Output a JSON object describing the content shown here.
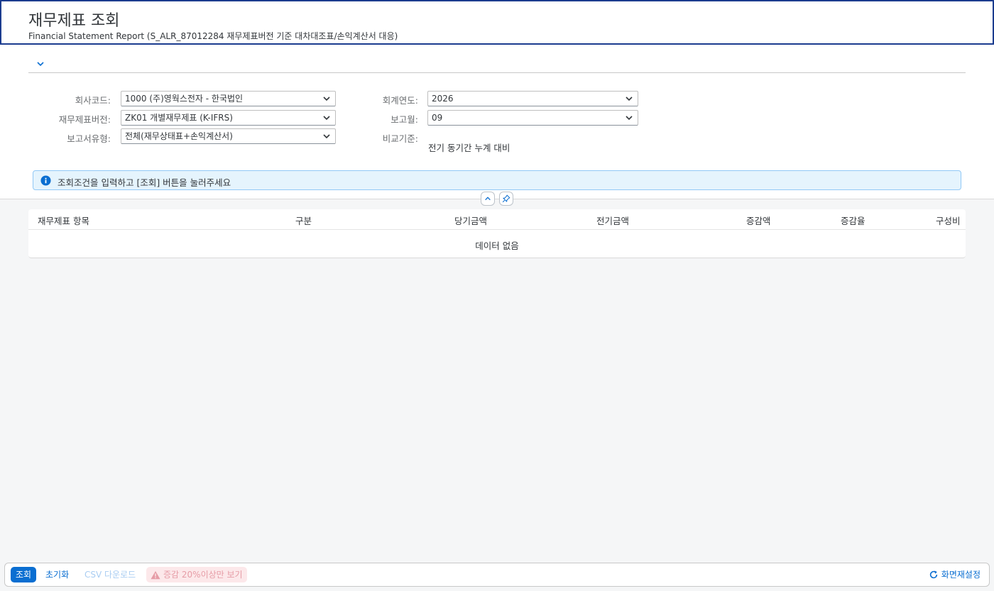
{
  "header": {
    "title": "재무제표 조회",
    "subtitle": "Financial Statement Report (S_ALR_87012284 재무제표버전 기준 대차대조표/손익계산서 대응)"
  },
  "filters": {
    "company_code": {
      "label": "회사코드:",
      "value": "1000 (주)영웍스전자 - 한국법인"
    },
    "fs_version": {
      "label": "재무제표버전:",
      "value": "ZK01 개별재무제표 (K-IFRS)"
    },
    "report_type": {
      "label": "보고서유형:",
      "value": "전체(재무상태표+손익계산서)"
    },
    "fiscal_year": {
      "label": "회계연도:",
      "value": "2026"
    },
    "period": {
      "label": "보고월:",
      "value": "09"
    },
    "comparison": {
      "label": "비교기준:",
      "value": "전기 동기간 누계 대비"
    }
  },
  "info_message": "조회조건을 입력하고 [조회] 버튼을 눌러주세요",
  "table": {
    "columns": [
      "재무제표 항목",
      "구분",
      "당기금액",
      "전기금액",
      "증감액",
      "증감율",
      "구성비"
    ],
    "empty_text": "데이터 없음"
  },
  "footer": {
    "search_label": "조회",
    "reset_label": "초기화",
    "csv_label": "CSV 다운로드",
    "filter_label": "증감 20%이상만 보기",
    "screen_reset_label": "화면재설정"
  },
  "colors": {
    "primary": "#0a6ed1",
    "header_border": "#1b3c8f",
    "info_bg": "#e5f4fd",
    "warn_bg": "#fce8ea"
  },
  "icons": {
    "expand": "chevron-down-icon",
    "collapse": "chevron-up-icon",
    "pin": "pin-icon",
    "info": "info-icon",
    "warning": "warning-icon",
    "refresh": "refresh-icon",
    "dropdown": "chevron-down-icon"
  }
}
